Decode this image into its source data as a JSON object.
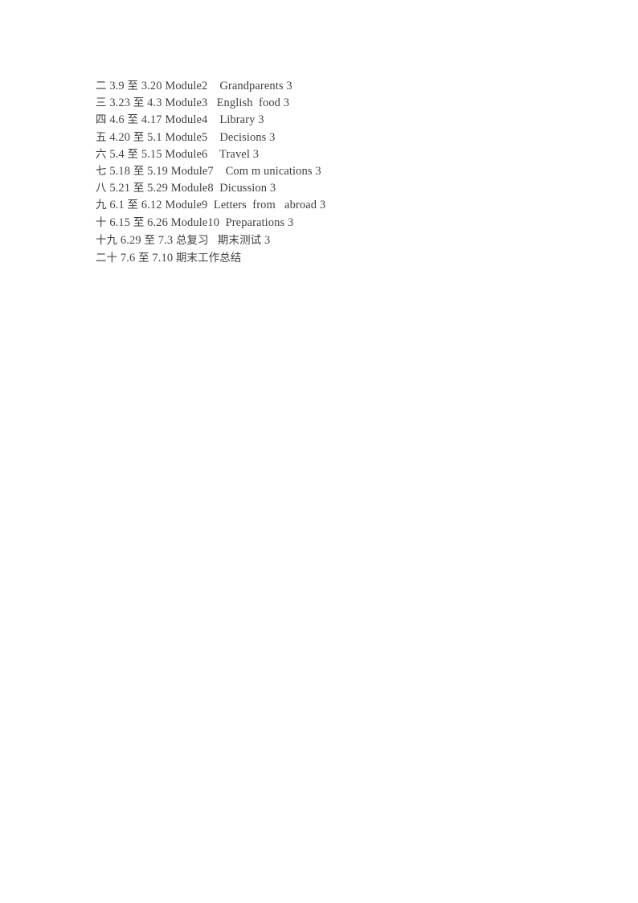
{
  "document": {
    "page_background": "#ffffff",
    "text_color": "#3f3f3f",
    "schedule_rows": [
      {
        "week": "二",
        "date_start": "3.9",
        "connector": "至",
        "date_end": "3.20",
        "module": "Module2",
        "topic": "Grandparents",
        "hours": "3",
        "gap_before_topic": "    ",
        "gap_before_hours": " "
      },
      {
        "week": "三",
        "date_start": "3.23",
        "connector": "至",
        "date_end": "4.3",
        "module": "Module3",
        "topic": "English  food",
        "hours": "3",
        "gap_before_topic": "   ",
        "gap_before_hours": " "
      },
      {
        "week": "四",
        "date_start": "4.6",
        "connector": "至",
        "date_end": "4.17",
        "module": "Module4",
        "topic": "Library",
        "hours": "3",
        "gap_before_topic": "    ",
        "gap_before_hours": " "
      },
      {
        "week": "五",
        "date_start": "4.20",
        "connector": "至",
        "date_end": "5.1",
        "module": "Module5",
        "topic": "Decisions",
        "hours": "3",
        "gap_before_topic": "    ",
        "gap_before_hours": " "
      },
      {
        "week": "六",
        "date_start": "5.4",
        "connector": "至",
        "date_end": "5.15",
        "module": "Module6",
        "topic": "Travel",
        "hours": "3",
        "gap_before_topic": "    ",
        "gap_before_hours": " "
      },
      {
        "week": "七",
        "date_start": "5.18",
        "connector": "至",
        "date_end": "5.19",
        "module": "Module7",
        "topic": "Com m unications",
        "hours": "3",
        "gap_before_topic": "    ",
        "gap_before_hours": " "
      },
      {
        "week": "八",
        "date_start": "5.21",
        "connector": "至",
        "date_end": "5.29",
        "module": "Module8",
        "topic": "Dicussion",
        "hours": "3",
        "gap_before_topic": "  ",
        "gap_before_hours": " "
      },
      {
        "week": "九",
        "date_start": "6.1",
        "connector": "至",
        "date_end": "6.12",
        "module": "Module9",
        "topic": "Letters  from   abroad",
        "hours": "3",
        "gap_before_topic": "  ",
        "gap_before_hours": " "
      },
      {
        "week": "十",
        "date_start": "6.15",
        "connector": "至",
        "date_end": "6.26",
        "module": "Module10",
        "topic": "Preparations",
        "hours": "3",
        "gap_before_topic": "  ",
        "gap_before_hours": " "
      },
      {
        "week": "十九",
        "date_start": "6.29",
        "connector": "至",
        "date_end": "7.3",
        "module": "总复习",
        "topic": "期末测试",
        "hours": "3",
        "gap_before_topic": "   ",
        "gap_before_hours": " ",
        "module_is_chinese": true,
        "topic_is_chinese": true
      },
      {
        "week": "二十",
        "date_start": "7.6",
        "connector": "至",
        "date_end": "7.10",
        "module": "期末工作总结",
        "topic": "",
        "hours": "",
        "gap_before_topic": "",
        "gap_before_hours": "",
        "module_is_chinese": true
      }
    ]
  }
}
